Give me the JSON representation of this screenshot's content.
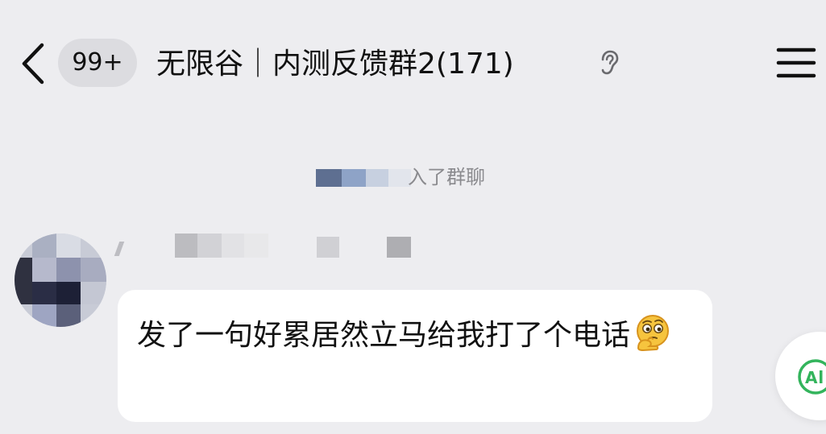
{
  "header": {
    "back_icon": "chevron-left-icon",
    "unread_badge": "99+",
    "title": "无限谷｜内测反馈群2(171)",
    "ear_icon": "ear-icon",
    "menu_icon": "menu-icon"
  },
  "system_message": {
    "text": "入了群聊"
  },
  "message": {
    "text": "发了一句好累居然立马给我打了个电话",
    "emoji": "thinking-face-emoji",
    "bubble_color": "#ffffff"
  },
  "floating": {
    "ai_icon": "ai-assistant-icon",
    "accent": "#33b45c"
  }
}
